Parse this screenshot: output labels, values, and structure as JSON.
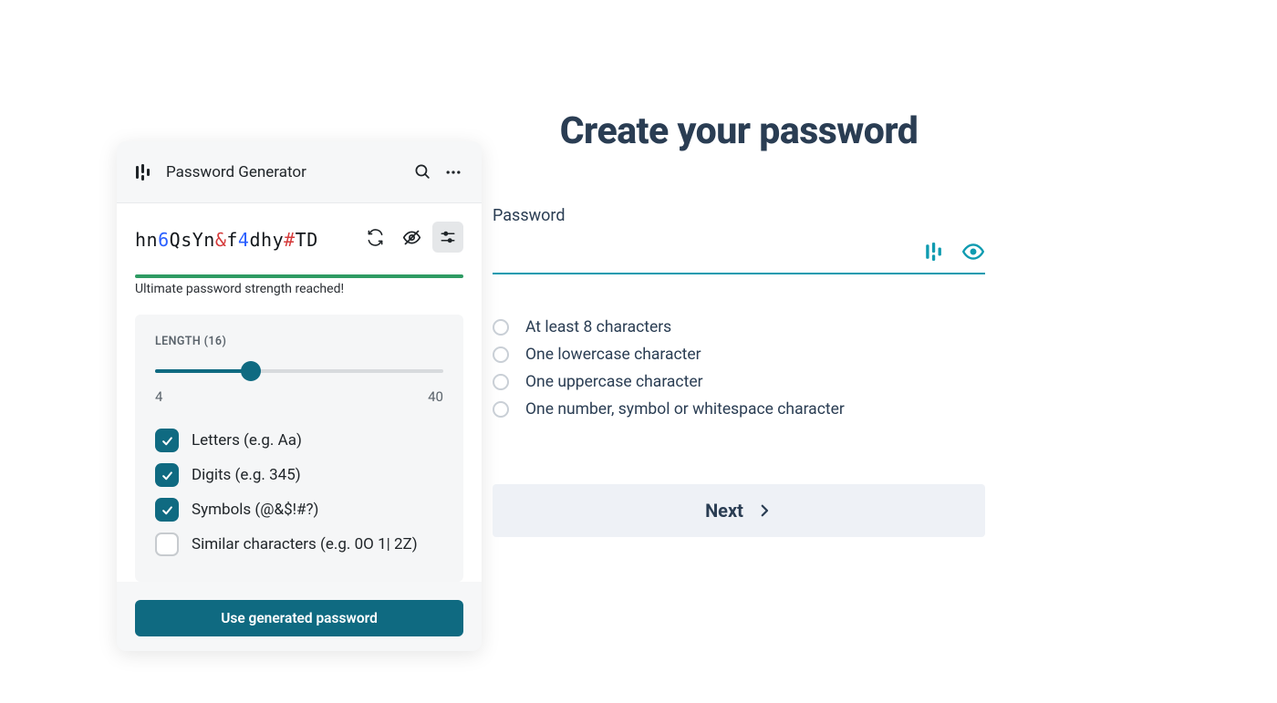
{
  "generator": {
    "title": "Password Generator",
    "password_chars": [
      {
        "c": "h",
        "t": "l"
      },
      {
        "c": "n",
        "t": "l"
      },
      {
        "c": "6",
        "t": "d"
      },
      {
        "c": "Q",
        "t": "l"
      },
      {
        "c": "s",
        "t": "l"
      },
      {
        "c": "Y",
        "t": "l"
      },
      {
        "c": "n",
        "t": "l"
      },
      {
        "c": "&",
        "t": "s"
      },
      {
        "c": "f",
        "t": "l"
      },
      {
        "c": "4",
        "t": "d"
      },
      {
        "c": "d",
        "t": "l"
      },
      {
        "c": "h",
        "t": "l"
      },
      {
        "c": "y",
        "t": "l"
      },
      {
        "c": "#",
        "t": "s"
      },
      {
        "c": "T",
        "t": "l"
      },
      {
        "c": "D",
        "t": "l"
      }
    ],
    "strength_label": "Ultimate password strength reached!",
    "length": {
      "label_prefix": "LENGTH",
      "value": 16,
      "min": 4,
      "max": 40
    },
    "options": [
      {
        "label": "Letters (e.g. Aa)",
        "checked": true
      },
      {
        "label": "Digits (e.g. 345)",
        "checked": true
      },
      {
        "label": "Symbols (@&$!#?)",
        "checked": true
      },
      {
        "label": "Similar characters (e.g. 0O 1| 2Z)",
        "checked": false
      }
    ],
    "use_button": "Use generated password"
  },
  "create": {
    "title": "Create your password",
    "field_label": "Password",
    "requirements": [
      "At least 8 characters",
      "One lowercase character",
      "One uppercase character",
      "One number, symbol or whitespace character"
    ],
    "next_button": "Next"
  }
}
